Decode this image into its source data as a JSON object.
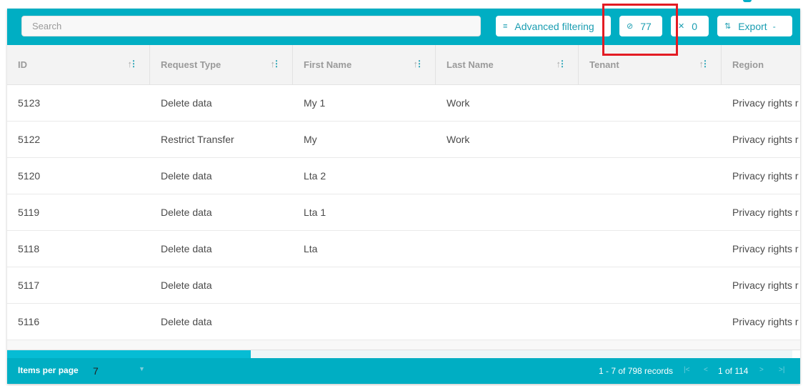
{
  "toolbar": {
    "search_placeholder": "Search",
    "advanced_filtering": {
      "icon": "filter-icon",
      "label": "Advanced filtering"
    },
    "hidden_columns": {
      "icon": "eye-slash-icon",
      "count": "77"
    },
    "pinned_columns": {
      "icon": "pin-icon",
      "count": "0"
    },
    "export": {
      "icon": "export-icon",
      "label": "Export",
      "caret": "-"
    }
  },
  "table": {
    "columns": [
      {
        "label": "ID",
        "sortable": true
      },
      {
        "label": "Request Type",
        "sortable": true
      },
      {
        "label": "First Name",
        "sortable": true
      },
      {
        "label": "Last Name",
        "sortable": true
      },
      {
        "label": "Tenant",
        "sortable": true
      },
      {
        "label": "Region",
        "sortable": false
      }
    ],
    "rows": [
      [
        "5123",
        "Delete data",
        "My 1",
        "Work",
        "",
        "Privacy rights r"
      ],
      [
        "5122",
        "Restrict Transfer",
        "My",
        "Work",
        "",
        "Privacy rights r"
      ],
      [
        "5120",
        "Delete data",
        "Lta 2",
        "",
        "",
        "Privacy rights r"
      ],
      [
        "5119",
        "Delete data",
        "Lta 1",
        "",
        "",
        "Privacy rights r"
      ],
      [
        "5118",
        "Delete data",
        "Lta",
        "",
        "",
        "Privacy rights r"
      ],
      [
        "5117",
        "Delete data",
        "",
        "",
        "",
        "Privacy rights r"
      ],
      [
        "5116",
        "Delete data",
        "",
        "",
        "",
        "Privacy rights r"
      ]
    ],
    "horizontal_scroll_fraction": 0.31
  },
  "footer": {
    "items_per_page_label": "Items per page",
    "items_per_page_value": "7",
    "records_summary": "1 - 7 of 798 records",
    "page_status": "1 of 114"
  },
  "colors": {
    "accent": "#00aec3",
    "button_text": "#1a9db1",
    "highlight": "#e31b23"
  }
}
